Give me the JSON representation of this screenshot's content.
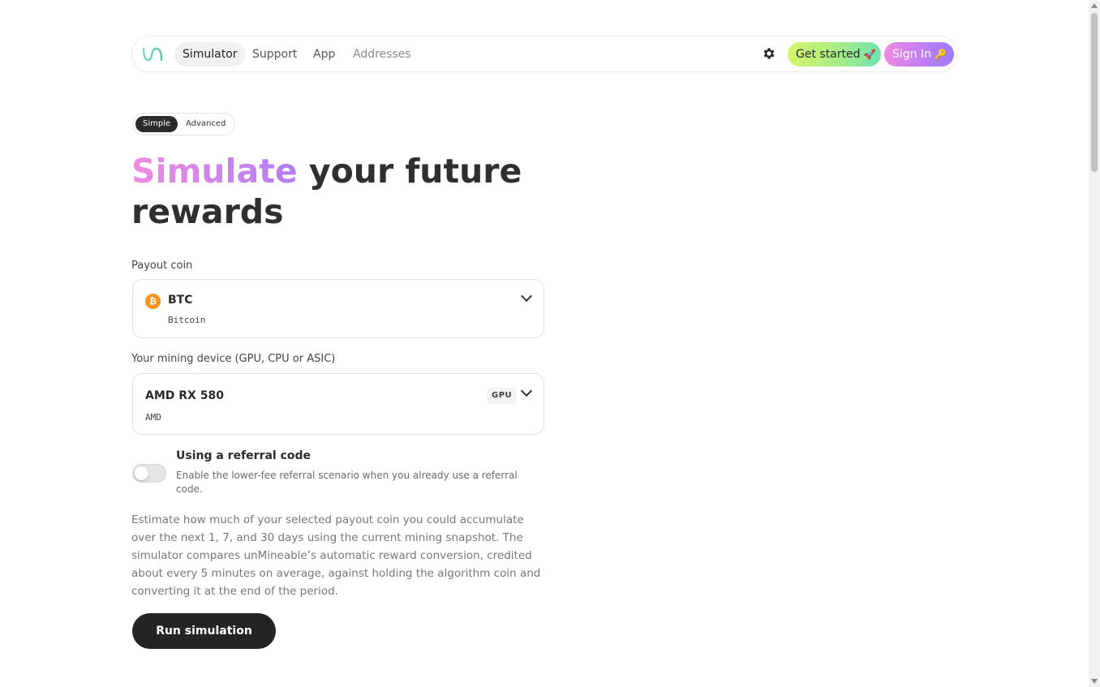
{
  "nav": {
    "items": [
      {
        "label": "Simulator"
      },
      {
        "label": "Support"
      },
      {
        "label": "App"
      },
      {
        "label": "Addresses"
      }
    ],
    "settings_icon": "gear-icon",
    "get_started_label": "Get started",
    "get_started_emoji": "🚀",
    "sign_in_label": "Sign In",
    "sign_in_emoji": "🔑"
  },
  "mode": {
    "simple_label": "Simple",
    "advanced_label": "Advanced",
    "selected": "Simple"
  },
  "title": {
    "accent": "Simulate",
    "rest": " your future rewards"
  },
  "payout": {
    "label": "Payout coin",
    "coin_icon": "bitcoin-icon",
    "coin_glyph": "₿",
    "symbol": "BTC",
    "name": "Bitcoin"
  },
  "device": {
    "label": "Your mining device (GPU, CPU or ASIC)",
    "name": "AMD RX 580",
    "brand": "AMD",
    "type_badge": "GPU"
  },
  "referral": {
    "title": "Using a referral code",
    "description": "Enable the lower-fee referral scenario when you already use a referral code.",
    "enabled": false
  },
  "description": "Estimate how much of your selected payout coin you could accumulate over the next 1, 7, and 30 days using the current mining snapshot. The simulator compares unMineable’s automatic reward conversion, credited about every 5 minutes on average, against holding the algorithm coin and converting it at the end of the period.",
  "run_button_label": "Run simulation",
  "colors": {
    "accent_pink": "#f08ae0",
    "accent_purple": "#9f7cf6",
    "accent_green": "#a7ec86",
    "bitcoin_orange": "#f7931a",
    "dark": "#242424"
  }
}
